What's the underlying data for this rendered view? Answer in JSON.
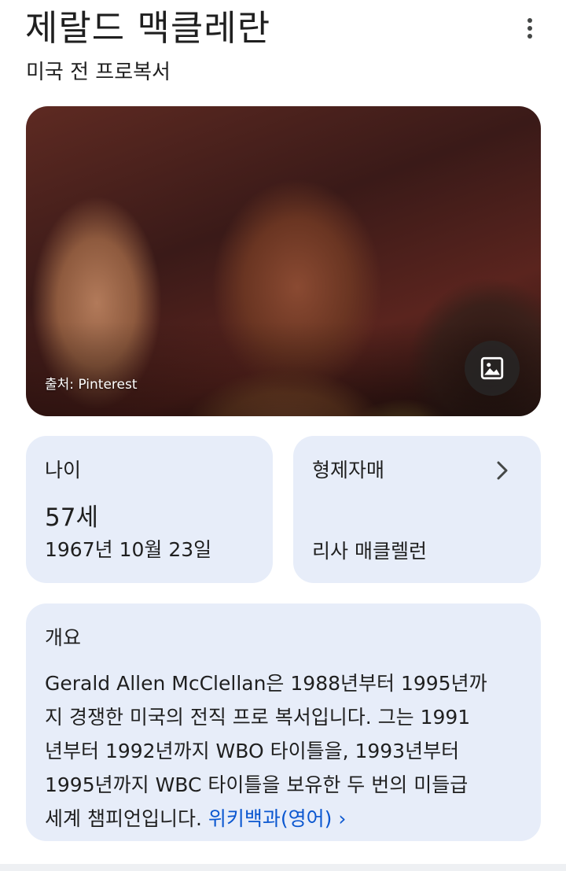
{
  "header": {
    "title": "제랄드 맥클레란",
    "subtitle": "미국 전 프로복서",
    "more_icon": "more-vert-icon"
  },
  "photo": {
    "source_label": "출처: Pinterest",
    "image_icon": "image-icon"
  },
  "age_card": {
    "label": "나이",
    "age": "57세",
    "birth_date": "1967년 10월 23일"
  },
  "siblings_card": {
    "label": "형제자매",
    "value": "리사 매클렐런",
    "chevron_icon": "chevron-right-icon"
  },
  "overview": {
    "label": "개요",
    "lines": [
      "Gerald Allen McClellan은 1988년부터 1995년까",
      "지 경쟁한 미국의 전직 프로 복서입니다. 그는 1991",
      "년부터 1992년까지 WBO 타이틀을, 1993년부터",
      "1995년까지 WBC 타이틀을 보유한 두 번의 미들급",
      "세계 챔피언입니다."
    ],
    "link_text": "위키백과(영어) ›"
  },
  "colors": {
    "card_bg": "#e7edf9",
    "link": "#0b57d0",
    "text": "#1f1f1f"
  }
}
